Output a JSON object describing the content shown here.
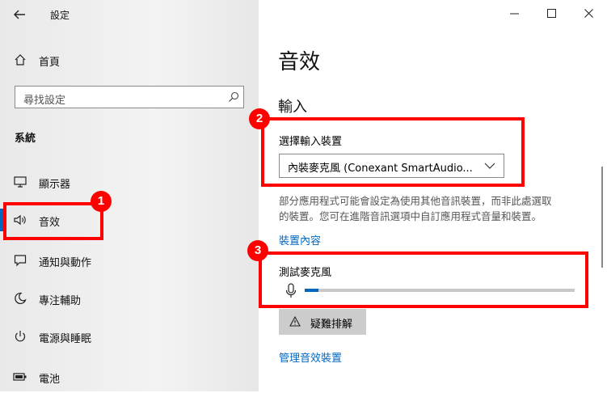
{
  "window": {
    "title": "設定"
  },
  "sidebar": {
    "home_label": "首頁",
    "search_placeholder": "尋找設定",
    "section_label": "系統",
    "items": [
      {
        "label": "顯示器",
        "icon": "monitor-icon"
      },
      {
        "label": "音效",
        "icon": "speaker-icon"
      },
      {
        "label": "通知與動作",
        "icon": "notification-icon"
      },
      {
        "label": "專注輔助",
        "icon": "moon-icon"
      },
      {
        "label": "電源與睡眠",
        "icon": "power-icon"
      },
      {
        "label": "電池",
        "icon": "battery-icon"
      }
    ]
  },
  "main": {
    "page_title": "音效",
    "input_heading": "輸入",
    "choose_device_label": "選擇輸入裝置",
    "device_selected": "內裝麥克風 (Conexant SmartAudio...",
    "device_note_line1": "部分應用程式可能會設定為使用其他音訊裝置，而非此處選取",
    "device_note_line2": "的裝置。您可在進階音訊選項中自訂應用程式音量和裝置。",
    "device_properties_link": "裝置內容",
    "test_mic_label": "測試麥克風",
    "mic_level": 0.05,
    "troubleshoot_label": "疑難排解",
    "manage_devices_link": "管理音效裝置"
  },
  "annotations": {
    "badge1": "1",
    "badge2": "2",
    "badge3": "3"
  },
  "colors": {
    "accent": "#0067c0",
    "highlight": "#ff0000"
  }
}
